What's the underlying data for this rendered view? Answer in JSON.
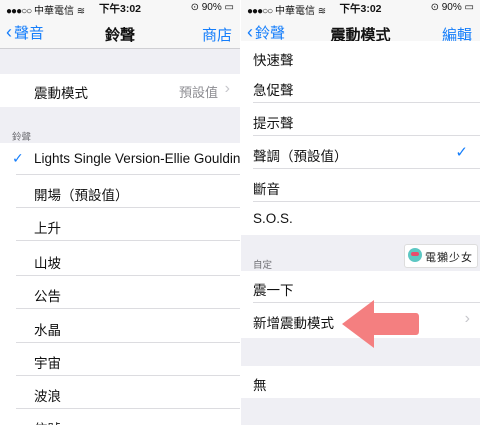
{
  "left": {
    "status": {
      "carrier": "中華電信",
      "time": "下午3:02",
      "battery": "90%"
    },
    "nav": {
      "back_label": "聲音",
      "title": "鈴聲",
      "action_label": "商店"
    },
    "vibration_row": {
      "label": "震動模式",
      "value": "預設值"
    },
    "section_label": "鈴聲",
    "ringtones": [
      "Lights Single Version-Ellie Goulding",
      "開場（預設值）",
      "上升",
      "山坡",
      "公告",
      "水晶",
      "宇宙",
      "波浪",
      "信號"
    ]
  },
  "right": {
    "status": {
      "carrier": "中華電信",
      "time": "下午3:02",
      "battery": "90%"
    },
    "nav": {
      "back_label": "鈴聲",
      "title": "震動模式",
      "action_label": "編輯"
    },
    "standard_items": [
      "快速聲",
      "急促聲",
      "提示聲",
      "聲調（預設值）",
      "斷音",
      "S.O.S."
    ],
    "custom_section_label": "自定",
    "custom_items": [
      "震一下",
      "新增震動模式"
    ],
    "none_item": "無",
    "watermark": "電獺少女"
  },
  "colors": {
    "accent": "#157efb",
    "group_bg": "#efeff4",
    "annotation_arrow": "#f47f80"
  }
}
